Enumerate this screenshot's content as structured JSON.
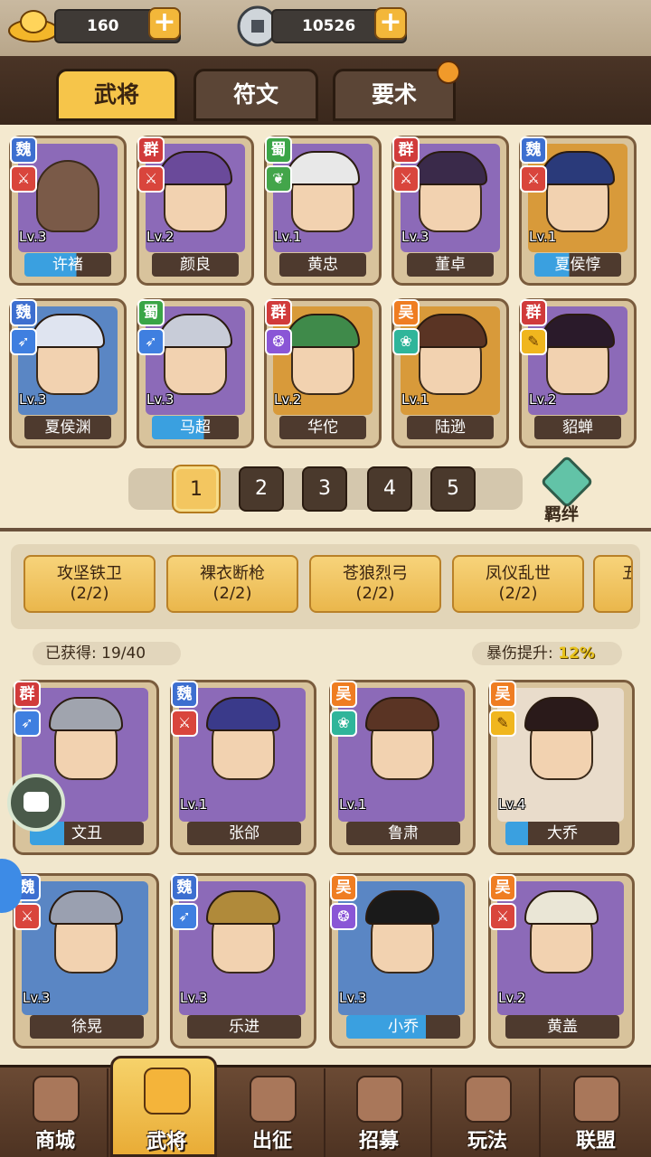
{
  "resources": {
    "ingot": "160",
    "coins": "10526"
  },
  "tabs": [
    {
      "label": "武将"
    },
    {
      "label": "符文"
    },
    {
      "label": "要术"
    }
  ],
  "roster": [
    {
      "faction": "魏",
      "name": "许褚",
      "level": "Lv.3"
    },
    {
      "faction": "群",
      "name": "颜良",
      "level": "Lv.2"
    },
    {
      "faction": "蜀",
      "name": "黄忠",
      "level": "Lv.1"
    },
    {
      "faction": "群",
      "name": "董卓",
      "level": "Lv.3"
    },
    {
      "faction": "魏",
      "name": "夏侯惇",
      "level": "Lv.1"
    },
    {
      "faction": "魏",
      "name": "夏侯渊",
      "level": "Lv.3"
    },
    {
      "faction": "蜀",
      "name": "马超",
      "level": "Lv.3"
    },
    {
      "faction": "群",
      "name": "华佗",
      "level": "Lv.2"
    },
    {
      "faction": "吴",
      "name": "陆逊",
      "level": "Lv.1"
    },
    {
      "faction": "群",
      "name": "貂蝉",
      "level": "Lv.2"
    }
  ],
  "pages": [
    "1",
    "2",
    "3",
    "4",
    "5"
  ],
  "bond_button": "羁绊",
  "bonds": [
    {
      "name": "攻坚铁卫",
      "count": "(2/2)"
    },
    {
      "name": "裸衣断枪",
      "count": "(2/2)"
    },
    {
      "name": "苍狼烈弓",
      "count": "(2/2)"
    },
    {
      "name": "凤仪乱世",
      "count": "(2/2)"
    },
    {
      "name": "五",
      "count": ""
    }
  ],
  "obtained": "已获得: 19/40",
  "crit_label": "暴伤提升: ",
  "crit_value": "12%",
  "collection": [
    {
      "faction": "群",
      "name": "文丑",
      "level": ""
    },
    {
      "faction": "魏",
      "name": "张郃",
      "level": "Lv.1"
    },
    {
      "faction": "吴",
      "name": "鲁肃",
      "level": "Lv.1"
    },
    {
      "faction": "吴",
      "name": "大乔",
      "level": "Lv.4"
    },
    {
      "faction": "魏",
      "name": "徐晃",
      "level": "Lv.3"
    },
    {
      "faction": "魏",
      "name": "乐进",
      "level": "Lv.3"
    },
    {
      "faction": "吴",
      "name": "小乔",
      "level": "Lv.3"
    },
    {
      "faction": "吴",
      "name": "黄盖",
      "level": "Lv.2"
    }
  ],
  "nav": [
    {
      "label": "商城"
    },
    {
      "label": "武将"
    },
    {
      "label": "出征"
    },
    {
      "label": "招募"
    },
    {
      "label": "玩法"
    },
    {
      "label": "联盟"
    }
  ],
  "colors": {
    "wei": "#3d6fd0",
    "qun": "#d13b3b",
    "shu": "#3aa547",
    "wu": "#ef7d22",
    "accent": "#f6c54a",
    "crit": "#e8c21a"
  }
}
